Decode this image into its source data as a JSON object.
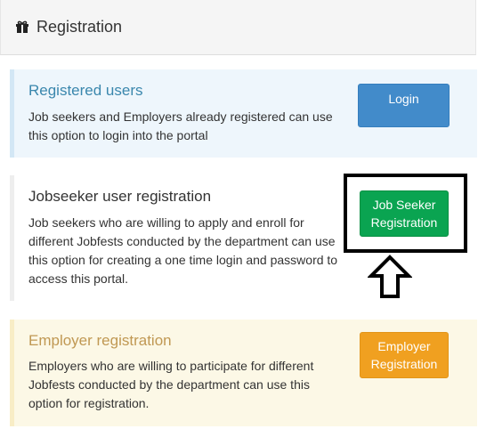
{
  "header": {
    "icon": "gift-icon",
    "title": "Registration"
  },
  "panels": [
    {
      "title": "Registered users",
      "description": "Job seekers and Employers already registered can use this option to login into the portal",
      "button": {
        "line1": "Login",
        "line2": ""
      },
      "title_color": "#3a87ad",
      "button_color": "#428bca"
    },
    {
      "title": "Jobseeker user registration",
      "description": "Job seekers who are willing to apply and enroll for different Jobfests conducted by the department can use this option for creating a one time login and password to access this portal.",
      "button": {
        "line1": "Job Seeker",
        "line2": "Registration"
      },
      "title_color": "#333333",
      "button_color": "#0aa451"
    },
    {
      "title": "Employer registration",
      "description": "Employers who are willing to participate for different Jobfests conducted by the department can use this option for registration.",
      "button": {
        "line1": "Employer",
        "line2": "Registration"
      },
      "title_color": "#c09853",
      "button_color": "#f0a020"
    }
  ],
  "annotation": {
    "highlight_box": "highlight-box",
    "arrow_icon": "up-arrow-icon"
  }
}
